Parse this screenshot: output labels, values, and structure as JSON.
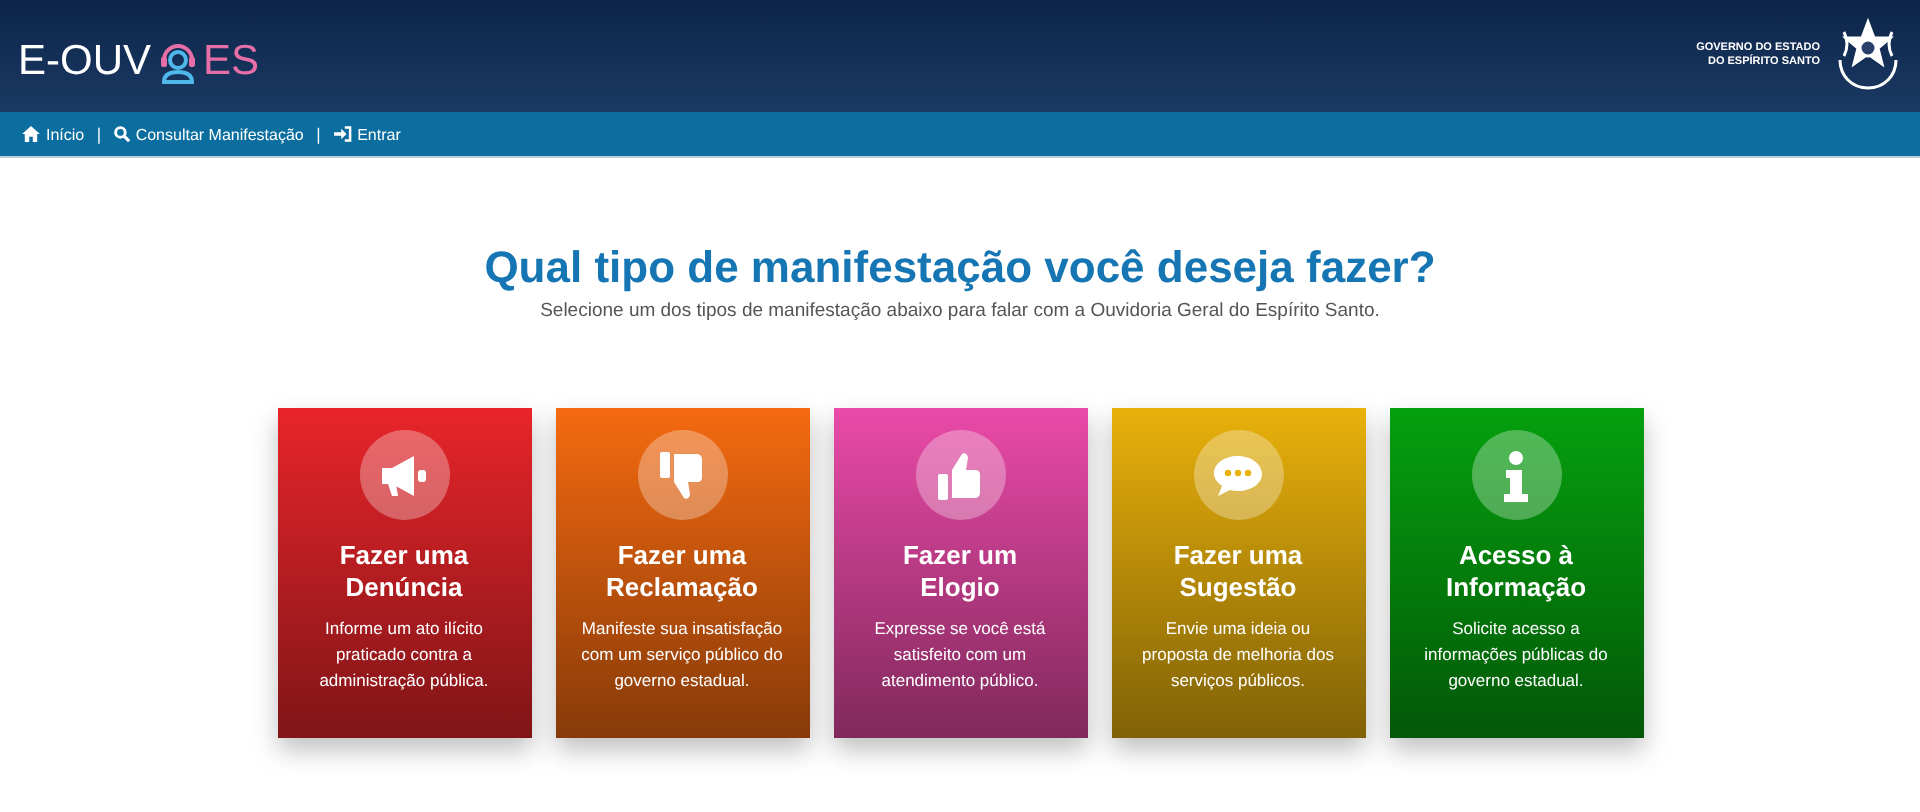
{
  "header": {
    "logo_left": "E-OUV",
    "logo_right": "ES",
    "government": [
      "GOVERNO DO ESTADO",
      "DO ESPÍRITO SANTO"
    ]
  },
  "nav": [
    {
      "label": "Início",
      "kind": "home"
    },
    {
      "label": "Consultar Manifestação",
      "kind": "search"
    },
    {
      "label": "Entrar",
      "kind": "signin"
    }
  ],
  "nav_separator": "|",
  "title": "Qual tipo de manifestação você deseja fazer?",
  "subtitle": "Selecione um dos tipos de manifestação abaixo para falar com a Ouvidoria Geral do Espírito Santo.",
  "cards": [
    {
      "kind": "megaphone",
      "color": "#e8252a",
      "title": [
        "Fazer uma",
        "Denúncia"
      ],
      "description": [
        "Informe um ato ilícito",
        "praticado contra a",
        "administração pública."
      ]
    },
    {
      "kind": "thumbs-down",
      "color": "#f56a10",
      "title": [
        "Fazer uma",
        "Reclamação"
      ],
      "description": [
        "Manifeste sua insatisfação",
        "com um serviço público do",
        "governo estadual."
      ]
    },
    {
      "kind": "thumbs-up",
      "color": "#ea4aa8",
      "title": [
        "Fazer um",
        "Elogio"
      ],
      "description": [
        "Expresse se você está",
        "satisfeito com um",
        "atendimento público."
      ]
    },
    {
      "kind": "comment",
      "color": "#e9b10b",
      "title": [
        "Fazer uma",
        "Sugestão"
      ],
      "description": [
        "Envie uma ideia ou",
        "proposta de melhoria dos",
        "serviços públicos."
      ]
    },
    {
      "kind": "info",
      "color": "#05a00e",
      "title": [
        "Acesso à",
        "Informação"
      ],
      "description": [
        "Solicite acesso a",
        "informações públicas do",
        "governo estadual."
      ]
    }
  ]
}
